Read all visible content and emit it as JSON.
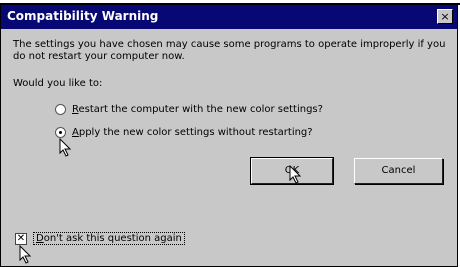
{
  "dialog": {
    "title": "Compatibility Warning",
    "close_glyph": "×",
    "message": "The settings you have chosen may cause some programs to operate improperly if you do not restart your computer now.",
    "question": "Would you like to:",
    "options": [
      {
        "accel": "R",
        "rest": "estart the computer with the new color settings?",
        "selected": false
      },
      {
        "accel": "A",
        "rest": "pply the new color settings without restarting?",
        "selected": true
      }
    ],
    "ok_label": "OK",
    "cancel_label": "Cancel",
    "dont_ask": {
      "accel": "D",
      "rest": "on't ask this question again",
      "checked": true,
      "check_glyph": "✕"
    }
  },
  "colors": {
    "titlebar": "#080874",
    "face": "#c8c8c8"
  },
  "icons": [
    "close-icon",
    "radio-icon",
    "checkbox-icon",
    "mouse-cursor-icon"
  ]
}
